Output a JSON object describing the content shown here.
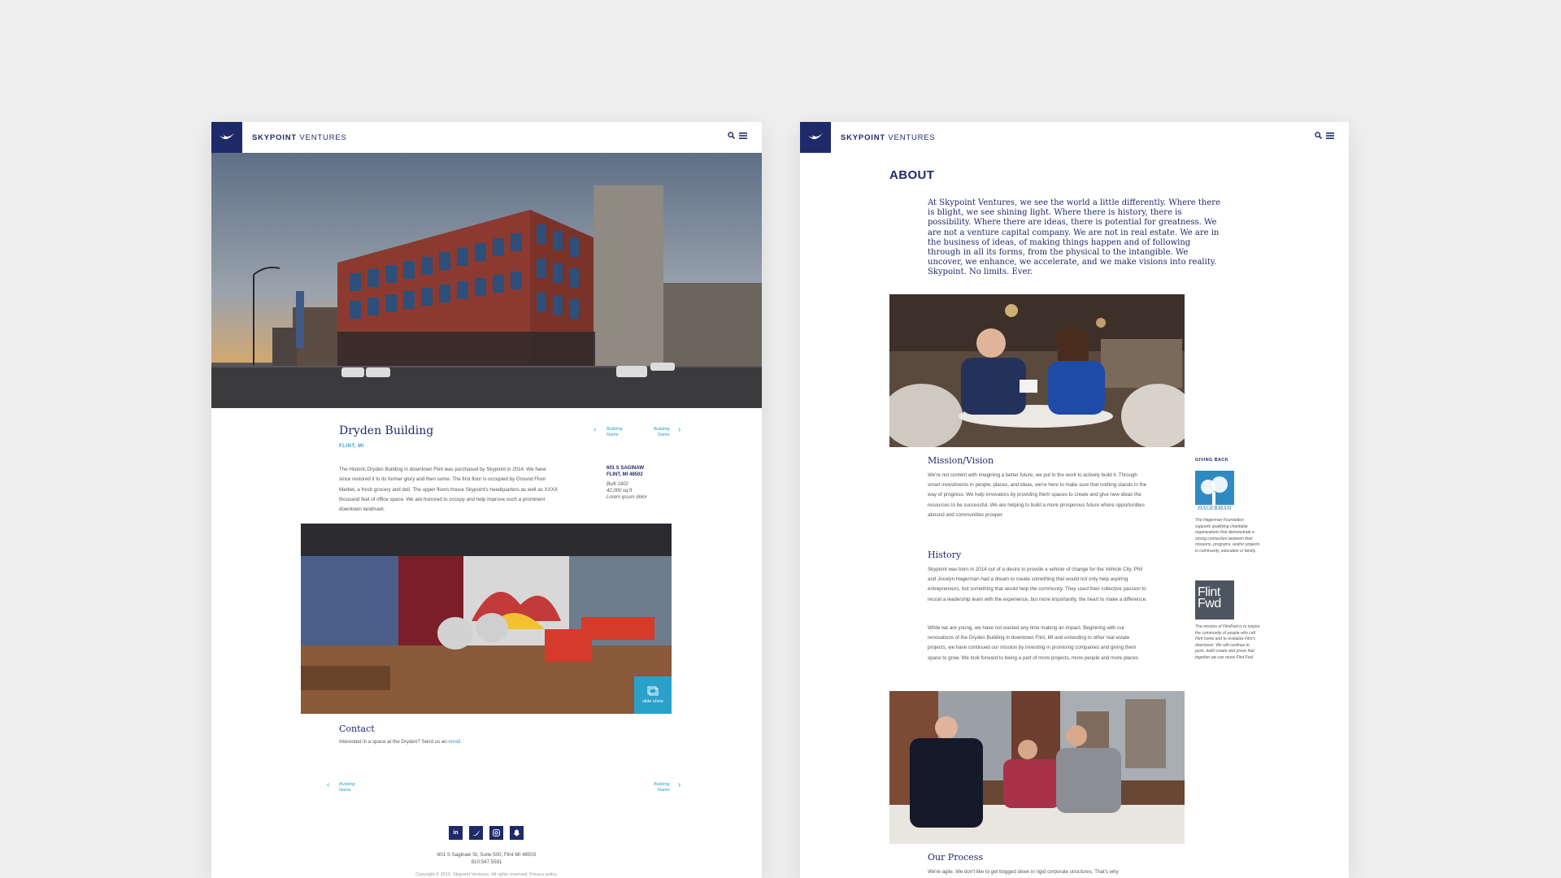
{
  "brand": {
    "name_bold": "SKYPOINT",
    "name_light": "VENTURES"
  },
  "colors": {
    "navy": "#1f2a6b",
    "accent": "#2aa1c9"
  },
  "left": {
    "title": "Dryden Building",
    "location": "FLINT, MI",
    "nav_prev": [
      "Building",
      "Name"
    ],
    "nav_next": [
      "Building",
      "Name"
    ],
    "description": "The Historic Dryden Building in downtown Flint was purchased by Skypoint in 2014. We have since restored it to its former glory and then some. The first floor is occupied by Ground Floor Market, a fresh grocery and deli. The upper floors house Skypoint's headquarters as well as XXXX thousand feet of office space. We are honored to occupy and help improve such a prominent downtown landmark.",
    "meta": {
      "addr1": "601 S SAGINAW",
      "addr2": "FLINT, MI 48502",
      "built": "Built 1902",
      "size": "42,000 sq ft",
      "extra": "Lorem ipsum dolor"
    },
    "slideshow_label": "slide show",
    "contact_heading": "Contact",
    "contact_text": "Interested in a space at the Dryden? Send us an",
    "contact_link": "email.",
    "footer_nav_prev": [
      "Building",
      "Name"
    ],
    "footer_nav_next": [
      "Building",
      "Name"
    ],
    "footer_address": "601 S Saginaw St, Suite 500, Flint MI 48503",
    "footer_phone": "810.547.5591",
    "footer_copyright": "Copyright © 2016. Skypoint Ventures. All rights reserved. Privacy policy."
  },
  "right": {
    "about_heading": "ABOUT",
    "about_text": "At Skypoint Ventures, we see the world a little differently. Where there is blight, we see shining light. Where there is history, there is possibility. Where there are ideas, there is potential for greatness. We are not a venture capital company. We are not in real estate. We are in the business of ideas, of making things happen and of following through in all its forms, from the physical to the intangible. We uncover, we enhance, we accelerate, and we make visions into reality. Skypoint. No limits. Ever.",
    "mission_heading": "Mission/Vision",
    "mission_text": "We're not content with imagining a better future, we put in the work to actively build it. Through smart investments in people, places, and ideas, we're here to make sure that nothing stands in the way of progress. We help innovators by providing them spaces to create and give new ideas the resources to be successful. We are helping to build a more prosperous future where opportunities abound and communities prosper.",
    "history_heading": "History",
    "history_text1": "Skypoint was born in 2014 out of a desire to provide a vehicle of change for the Vehicle City. Phil and Jocelyn Hagerman had a dream to create something that would not only help aspiring entrepreneurs, but something that would help the community. They used their collective passion to recruit a leadership team with the experience, but more importantly, the heart to make a difference.",
    "history_text2": "While we are young, we have not wasted any time making an impact. Beginning with our renovations of the Dryden Building in downtown Flint, MI and extending to other real estate projects, we have continued our mission by investing in promising companies and giving them space to grow. We look forward to being a part of more projects, more people and more places.",
    "giving_heading": "GIVING BACK",
    "hagerman_logo_text": "HAGERMAN",
    "hagerman_text": "The Hagerman Foundation supports qualifying charitable organizations that demonstrate a strong connection between their missions, programs, and/or projects in community, education or family.",
    "flint_logo_line1": "Flint",
    "flint_logo_line2": "Fwd",
    "flint_text": "The mission of FlintFwd is to inspire the community of people who call Flint home and to revitalize Flint's downtown. We will continue to push, build create and prove that together we can move Flint Fwd.",
    "process_heading": "Our Process",
    "process_text": "We're agile. We don't like to get bogged down in rigid corporate structures. That's why"
  }
}
